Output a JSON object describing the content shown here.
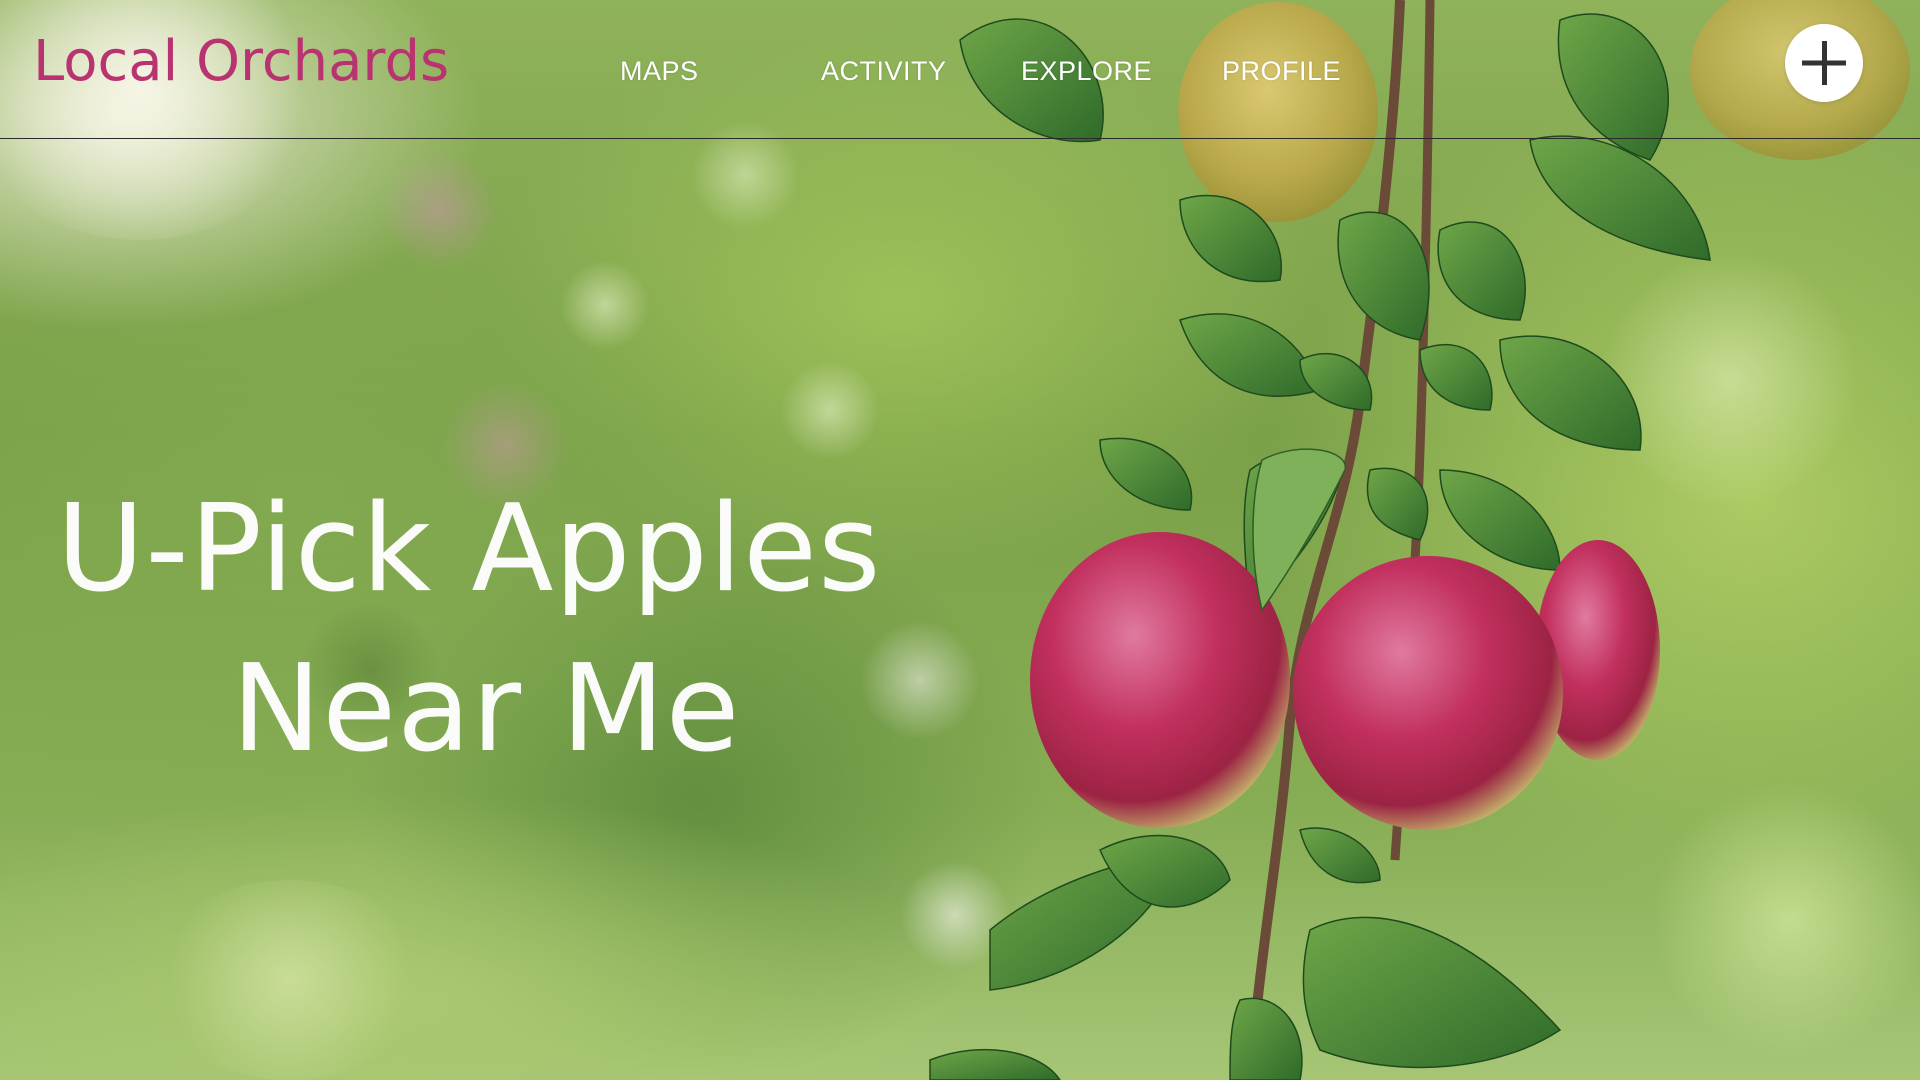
{
  "header": {
    "brand": "Local Orchards",
    "nav": {
      "maps": "MAPS",
      "activity": "ACTIVITY",
      "explore": "EXPLORE",
      "profile": "PROFILE"
    },
    "add_button_icon": "plus-icon"
  },
  "hero": {
    "line1": "U-Pick Apples",
    "line2": "Near Me"
  },
  "background": {
    "image_subject": "apple-branch-photo"
  },
  "colors": {
    "brand": "#b8336f",
    "nav_text": "#ffffff",
    "hero_text": "#ffffff",
    "divider": "#2a2a2a",
    "add_button_bg": "#ffffff",
    "add_button_icon": "#333333"
  }
}
